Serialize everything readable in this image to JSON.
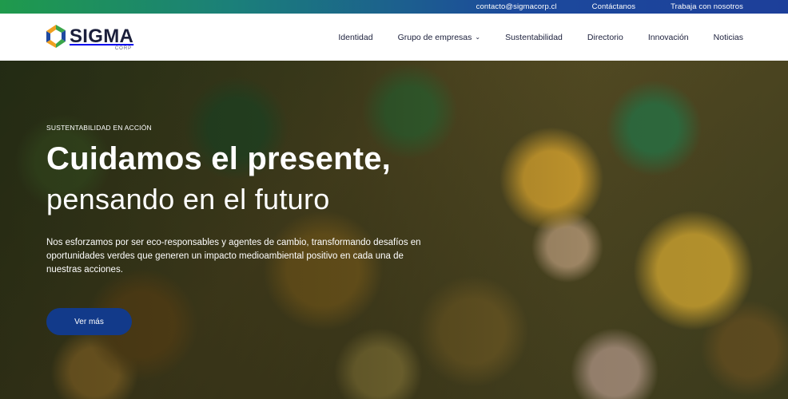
{
  "topbar": {
    "email": "contacto@sigmacorp.cl",
    "contact": "Contáctanos",
    "jobs": "Trabaja con nosotros"
  },
  "brand": {
    "name": "SIGMA",
    "sub": "CORP",
    "colors": {
      "green": "#3aa54a",
      "blue": "#1f4aa0",
      "orange": "#f0a020",
      "navy": "#1b1f3b"
    }
  },
  "nav": {
    "items": [
      {
        "label": "Identidad"
      },
      {
        "label": "Grupo de empresas",
        "has_dropdown": true
      },
      {
        "label": "Sustentabilidad"
      },
      {
        "label": "Directorio"
      },
      {
        "label": "Innovación"
      },
      {
        "label": "Noticias"
      }
    ],
    "dropdown_icon": "chevron-down-icon"
  },
  "hero": {
    "kicker": "SUSTENTABILIDAD EN ACCIÓN",
    "title_line1": "Cuidamos el presente,",
    "title_line2": "pensando en el futuro",
    "description": "Nos esforzamos por ser eco-responsables y agentes de cambio, transformando desafíos en oportunidades verdes que generen un impacto medioambiental positivo en cada una de nuestras acciones.",
    "cta_label": "Ver más",
    "cta_color": "#123a8a"
  }
}
